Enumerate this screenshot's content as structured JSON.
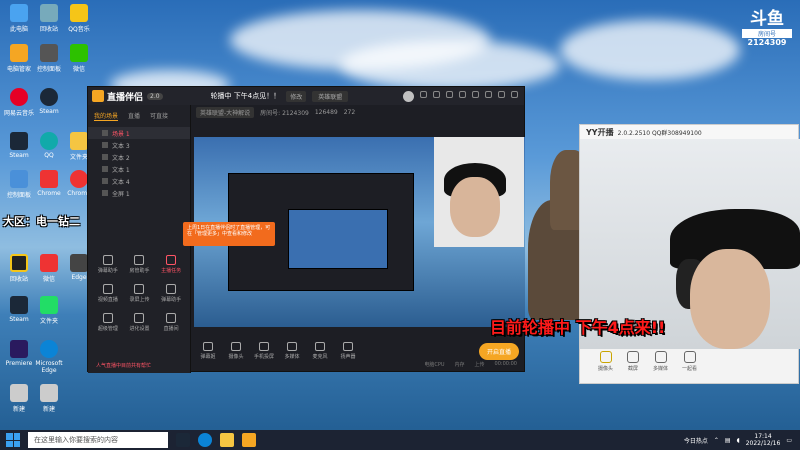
{
  "desktop": {
    "icons": [
      {
        "label": "此电脑",
        "color": "#4aa3f0"
      },
      {
        "label": "回收站",
        "color": "#7ab"
      },
      {
        "label": "QQ音乐",
        "color": "#f5c518"
      },
      {
        "label": "电脑管家",
        "color": "#f5a623"
      },
      {
        "label": "控制面板",
        "color": "#4a90d9"
      },
      {
        "label": "微信",
        "color": "#2dc100"
      },
      {
        "label": "网易云音乐",
        "color": "#e60026"
      },
      {
        "label": "Steam",
        "color": "#1b2838"
      },
      {
        "label": "Chrome",
        "color": "#e33"
      },
      {
        "label": "QQ",
        "color": "#1aa"
      },
      {
        "label": "文件夹",
        "color": "#f5c542"
      },
      {
        "label": "Edge",
        "color": "#0b84d6"
      },
      {
        "label": "Premiere",
        "color": "#2a1a5e"
      },
      {
        "label": "Microsoft Edge",
        "color": "#0b84d6"
      },
      {
        "label": "新建",
        "color": "#ccc"
      }
    ],
    "overlay_text": "大区：电一钻二",
    "big_caption": "目前轮播中 下午4点来!!",
    "douyu": {
      "logo": "斗鱼",
      "sub": "房间号",
      "room": "2124309"
    }
  },
  "main_window": {
    "app_name": "直播伴侣",
    "version": "2.0",
    "room_title": "轮播中 下午4点见！！",
    "edit_label": "修改",
    "game_tag": "英雄联盟",
    "subbar": {
      "category": "英雄联盟-大神解说",
      "room": "房间号: 2124309",
      "fans": "126489",
      "viewers": "272"
    },
    "side_tabs": [
      "我的场景",
      "直播",
      "可直接"
    ],
    "scenes": [
      "场景 1",
      "文本 3",
      "文本 2",
      "文本 1",
      "文本 4",
      "全屏 1"
    ],
    "tools": [
      "弹幕助手",
      "房管助手",
      "主播任务",
      "视频直播",
      "录屏上传",
      "弹幕助手",
      "超级管理",
      "进化设置",
      "直播间"
    ],
    "toast": "上周1日在直播伴侣时了直播管理，可在「管理更多」中查看和修改",
    "side_footer": "人气直播中目前共有帮忙",
    "bottom_items": [
      "弹幕姬",
      "摄像头",
      "手机投屏",
      "多媒体",
      "麦克风",
      "扬声器"
    ],
    "start_live": "开启直播",
    "status": [
      "电脑CPU",
      "内存",
      "上传",
      "00:00:00"
    ]
  },
  "yy_window": {
    "title": "YY开播",
    "version": "2.0.2.2510 QQ群308949100",
    "tools": [
      "摄像头",
      "截屏",
      "多媒体",
      "一起看"
    ]
  },
  "taskbar": {
    "search_placeholder": "在这里输入你要搜索的内容",
    "weather": "今日热点",
    "time": "17:14",
    "date": "2022/12/16"
  },
  "colors": {
    "accent": "#f5a623",
    "caption_red": "#ff1a1a",
    "toast": "#f26b1d"
  }
}
